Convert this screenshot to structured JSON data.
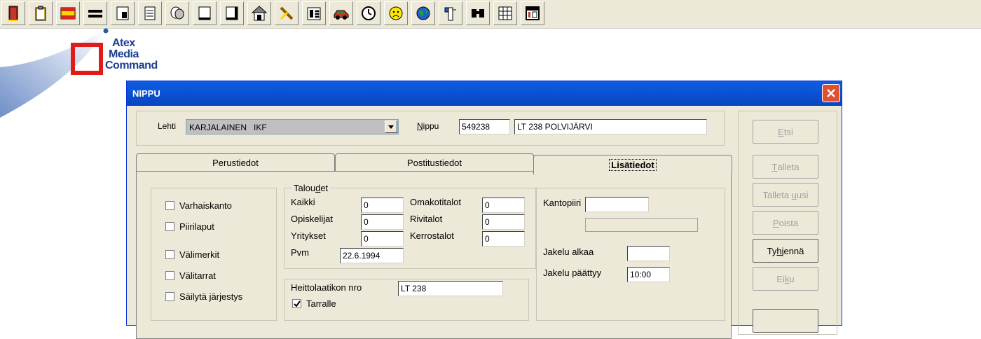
{
  "toolbar": {
    "icons": [
      "door-exit-icon",
      "clipboard-icon",
      "flag-icon",
      "equals-icon",
      "stamp-icon",
      "notepad-icon",
      "masks-icon",
      "document-icon",
      "document-alt-icon",
      "house-icon",
      "tools-icon",
      "telephone-icon",
      "car-icon",
      "clock-icon",
      "face-icon",
      "globe-icon",
      "mailbox-icon",
      "binoculars-icon",
      "grid-icon",
      "calendar-icon"
    ]
  },
  "logo": {
    "line1": "Atex",
    "line2": "Media",
    "line3": "Command"
  },
  "window": {
    "title": "NIPPU",
    "lehti_label": "Lehti",
    "lehti_value": "KARJALAINEN   IKF",
    "nippu_label_first": "N",
    "nippu_label_rest": "ippu",
    "nippu_number": "549238",
    "nippu_name": "LT 238  POLVIJÄRVI"
  },
  "tabs": [
    {
      "label": "Perustiedot"
    },
    {
      "label": "Postitustiedot"
    },
    {
      "label": "Lisätiedot"
    }
  ],
  "checkboxes": [
    {
      "label": "Varhaiskanto",
      "checked": false
    },
    {
      "label": "Piirilaput",
      "checked": false
    },
    {
      "label": "Välimerkit",
      "checked": false
    },
    {
      "label": "Välitarrat",
      "checked": false
    },
    {
      "label": "Säilytä järjestys",
      "checked": false
    }
  ],
  "taloudet": {
    "title_pre": "Talou",
    "title_u": "d",
    "title_post": "et",
    "kaikki_label": "Kaikki",
    "kaikki_value": "0",
    "opiskelijat_label": "Opiskelijat",
    "opiskelijat_value": "0",
    "yritykset_label": "Yritykset",
    "yritykset_value": "0",
    "pvm_label": "Pvm",
    "pvm_value": "22.6.1994",
    "omakotitalot_label": "Omakotitalot",
    "omakotitalot_value": "0",
    "rivitalot_label": "Rivitalot",
    "rivitalot_value": "0",
    "kerrostalot_label": "Kerrostalot",
    "kerrostalot_value": "0"
  },
  "heittolaatikko": {
    "label": "Heittolaatikon nro",
    "value": "LT 238",
    "tarralle_label": "Tarralle",
    "tarralle_checked": true
  },
  "jakelu": {
    "kantopiiri_label": "Kantopiiri",
    "kantopiiri_value": "",
    "kantopiiri_desc": "",
    "alkaa_label": "Jakelu alkaa",
    "alkaa_value": "",
    "paattyy_label": "Jakelu päättyy",
    "paattyy_value": "10:00"
  },
  "buttons": [
    {
      "pre": "",
      "u": "E",
      "post": "tsi",
      "enabled": false
    },
    {
      "pre": "",
      "u": "T",
      "post": "alleta",
      "enabled": false
    },
    {
      "pre": "Talleta ",
      "u": "u",
      "post": "usi",
      "enabled": false
    },
    {
      "pre": "",
      "u": "P",
      "post": "oista",
      "enabled": false
    },
    {
      "pre": "Ty",
      "u": "h",
      "post": "jennä",
      "enabled": true
    },
    {
      "pre": "Ei",
      "u": "k",
      "post": "u",
      "enabled": false
    }
  ]
}
